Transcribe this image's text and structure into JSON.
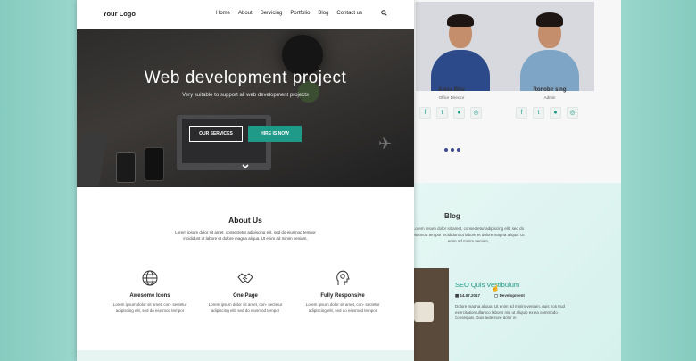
{
  "nav": {
    "logo": "Your Logo",
    "menu": [
      "Home",
      "About",
      "Servicing",
      "Portfolio",
      "Blog",
      "Contact us"
    ]
  },
  "hero": {
    "title": "Web development project",
    "subtitle": "Very suitable to support all web development projects",
    "btn_services": "OUR SERVICES",
    "btn_hire": "HIRE IS NOW"
  },
  "about": {
    "title": "About Us",
    "text": "Lorem ipsum dolor sit amet, consectetur adipiscing elit, sed do eiusmod tempor incididunt ut labore et dolore magna aliqua. Ut enim ad minim veniam,",
    "features": [
      {
        "icon": "globe-icon",
        "title": "Awesome Icons",
        "text": "Lorem ipsum dolor sit amet, con- sectetur adipiscing elit, sed do eiusmod tempor"
      },
      {
        "icon": "handshake-icon",
        "title": "One Page",
        "text": "Lorem ipsum dolor sit amet, con- sectetur adipiscing elit, sed do eiusmod tempor"
      },
      {
        "icon": "head-gear-icon",
        "title": "Fully Responsive",
        "text": "Lorem ipsum dolor sit amet, con- sectetur adipiscing elit, sed do eiusmod tempor"
      }
    ]
  },
  "team": [
    {
      "name": "Alexa Biru",
      "role": "Office Director"
    },
    {
      "name": "Ronobir sing",
      "role": "Admin"
    }
  ],
  "blog": {
    "title": "Blog",
    "text": "Lorem ipsum dolor sit amet, consectetur adipiscing elit, sed do eiusmod tempor incididunt ut labore et dolore magna aliqua. Ut enim ad minim veniam,",
    "post": {
      "title": "SEO Quis Vestibulum",
      "date": "14.07.2017",
      "category": "Development",
      "text": "Dolore magna aliqua. Ut enim ad minim veniam, quis nos trud exercitation ullamco laboris nisi ut aliquip ex ea commodo consequat. Duis aute irure dolor in"
    }
  },
  "colors": {
    "accent": "#1f9a88",
    "background": "#8fcfc4"
  }
}
